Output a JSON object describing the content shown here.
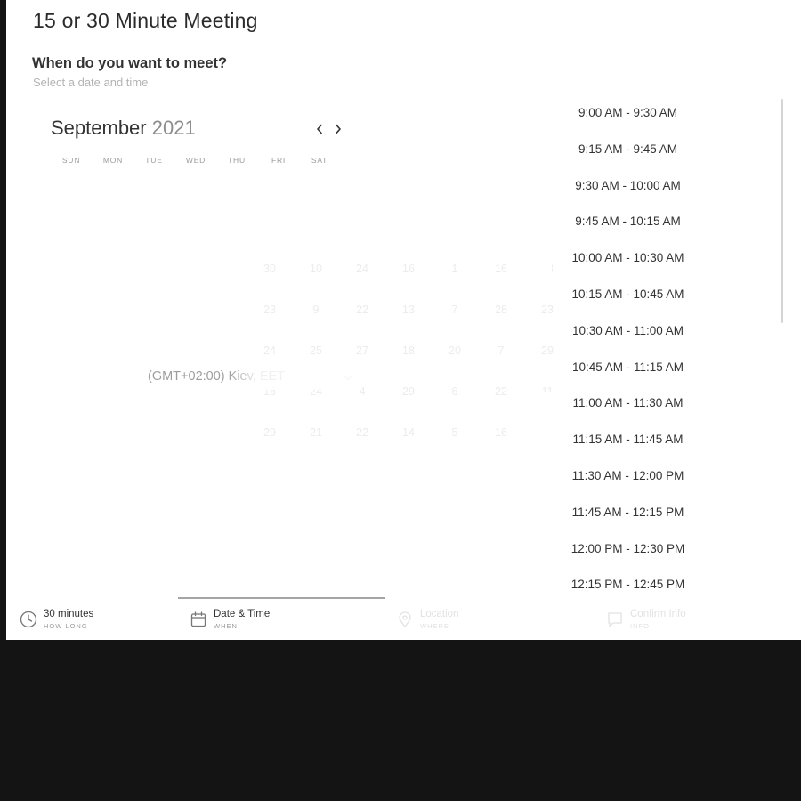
{
  "header": {
    "title": "15 or 30 Minute Meeting",
    "question": "When do you want to meet?",
    "subtext": "Select a date and time"
  },
  "calendar": {
    "month": "September",
    "year": "2021",
    "weekdays": [
      "SUN",
      "MON",
      "TUE",
      "WED",
      "THU",
      "FRI",
      "SAT"
    ],
    "faint_dates": [
      [
        "30",
        "10",
        "24",
        "16",
        "1",
        "16",
        "13"
      ],
      [
        "23",
        "9",
        "22",
        "13",
        "7",
        "28",
        "23"
      ],
      [
        "24",
        "25",
        "27",
        "18",
        "20",
        "7",
        "29"
      ],
      [
        "16",
        "24",
        "4",
        "29",
        "6",
        "22",
        "11"
      ],
      [
        "29",
        "21",
        "22",
        "14",
        "5",
        "16",
        "23"
      ]
    ]
  },
  "timezone": {
    "label": "(GMT+02:00) Kiev, EET"
  },
  "time_slots": [
    "9:00 AM - 9:30 AM",
    "9:15 AM - 9:45 AM",
    "9:30 AM - 10:00 AM",
    "9:45 AM - 10:15 AM",
    "10:00 AM - 10:30 AM",
    "10:15 AM - 10:45 AM",
    "10:30 AM - 11:00 AM",
    "10:45 AM - 11:15 AM",
    "11:00 AM - 11:30 AM",
    "11:15 AM - 11:45 AM",
    "11:30 AM - 12:00 PM",
    "11:45 AM - 12:15 PM",
    "12:00 PM - 12:30 PM",
    "12:15 PM - 12:45 PM"
  ],
  "steps": [
    {
      "label": "30 minutes",
      "sub": "HOW LONG",
      "icon": "clock-icon"
    },
    {
      "label": "Date & Time",
      "sub": "WHEN",
      "icon": "calendar-icon"
    },
    {
      "label": "Location",
      "sub": "WHERE",
      "icon": "location-pin-icon"
    },
    {
      "label": "Confirm Info",
      "sub": "INFO",
      "icon": "chat-icon"
    }
  ]
}
